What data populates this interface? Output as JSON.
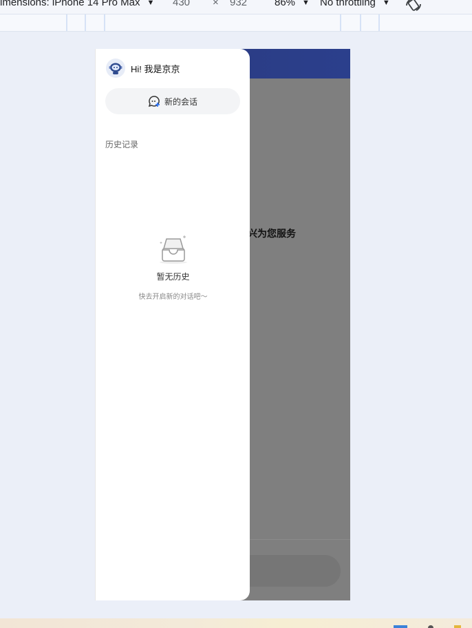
{
  "devtools": {
    "dimensions_label": "imensions: iPhone 14 Pro Max",
    "width": "430",
    "times": "×",
    "height": "932",
    "zoom": "86%",
    "throttling": "No throttling",
    "caret": "▼"
  },
  "app": {
    "welcome_text": "兴为您服务"
  },
  "drawer": {
    "greeting": "Hi! 我是京京",
    "new_chat_label": "新的会话",
    "history_title": "历史记录",
    "empty_title": "暂无历史",
    "empty_subtitle": "快去开启新的对话吧～"
  },
  "colors": {
    "accent": "#2b3f8c",
    "overlay": "#7f7f7f",
    "drawer_bg": "#ffffff",
    "pill_bg": "#f3f4f6",
    "icon_blue": "#3478f6"
  }
}
